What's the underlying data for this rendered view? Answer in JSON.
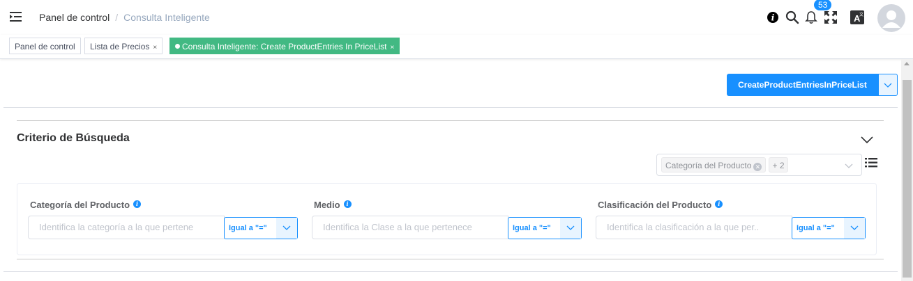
{
  "breadcrumb": {
    "first": "Panel de control",
    "separator": "/",
    "current": "Consulta Inteligente"
  },
  "header": {
    "notification_count": "53"
  },
  "tags": [
    {
      "label": "Panel de control"
    },
    {
      "label": "Lista de Precios",
      "close": "×"
    },
    {
      "label": "Consulta Inteligente: Create ProductEntries In PriceList",
      "close": "×"
    }
  ],
  "action": {
    "label": "CreateProductEntriesInPriceList"
  },
  "search": {
    "title": "Criterio de Búsqueda",
    "selected_chip": "Categoría del Producto",
    "more_chip": "+ 2"
  },
  "fields": [
    {
      "label": "Categoría del Producto",
      "placeholder": "Identifica la categoría a la que pertene",
      "operator": "Igual a \"=\""
    },
    {
      "label": "Medio",
      "placeholder": "Identifica la Clase a la que pertenece",
      "operator": "Igual a \"=\""
    },
    {
      "label": "Clasificación del Producto",
      "placeholder": "Identifica la clasificación a la que per..",
      "operator": "Igual a \"=\""
    }
  ],
  "colors": {
    "primary": "#1890ff",
    "active_tag": "#42b983"
  },
  "icons": [
    "menu-fold-icon",
    "info-icon",
    "search-icon",
    "bell-icon",
    "fullscreen-icon",
    "translate-icon",
    "avatar-icon"
  ]
}
